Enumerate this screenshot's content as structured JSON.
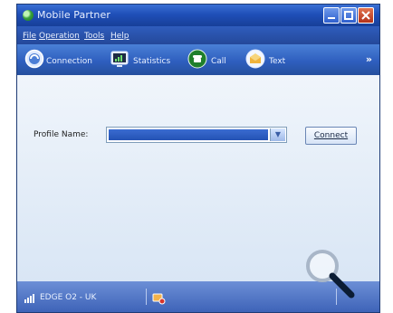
{
  "window": {
    "title": "Mobile Partner"
  },
  "menu": {
    "items": [
      "File",
      "Operation",
      "Tools",
      "Help"
    ]
  },
  "toolbar": {
    "connection": "Connection",
    "statistics": "Statistics",
    "call": "Call",
    "text": "Text"
  },
  "main": {
    "profile_label": "Profile Name:",
    "profile_selected": "",
    "connect_label": "Connect"
  },
  "status": {
    "network": "EDGE O2 - UK"
  },
  "colors": {
    "title_blue": "#1f4fb8",
    "toolbar_blue": "#2f5fbf",
    "content_bg": "#e3edf8",
    "selection_blue": "#2452b4",
    "close_red": "#b3321a"
  }
}
